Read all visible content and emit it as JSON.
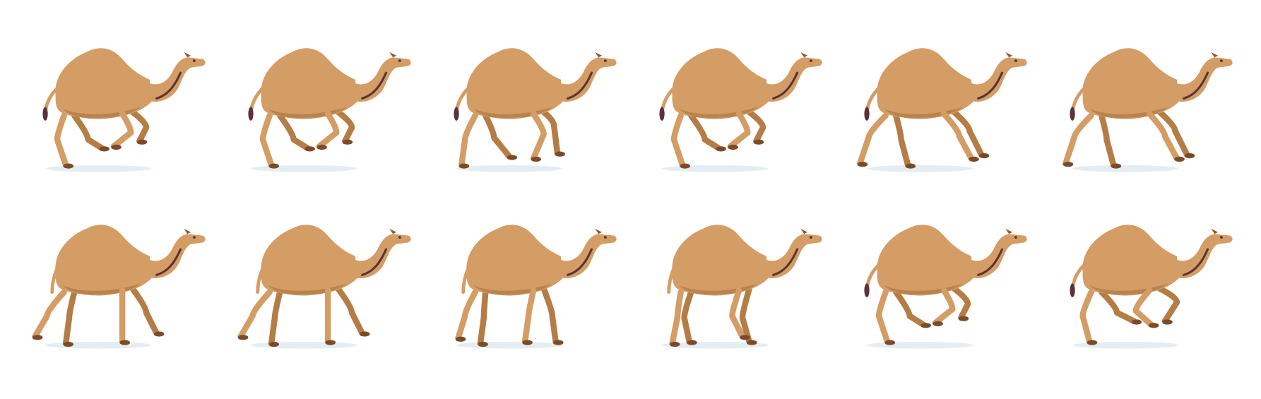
{
  "sprite_sheet": {
    "subject": "camel",
    "colors": {
      "background": "#ffffff",
      "body": "#d39d65",
      "shade": "#b57d46",
      "dark": "#8d5a31",
      "hoof": "#7b4b29",
      "tail": "#5a3337",
      "shadow": "#d9e6ec"
    },
    "frames": [
      {
        "row": 1,
        "col": 1,
        "pose": "gallop-gather"
      },
      {
        "row": 1,
        "col": 2,
        "pose": "gallop-gather"
      },
      {
        "row": 1,
        "col": 3,
        "pose": "gallop-reach"
      },
      {
        "row": 1,
        "col": 4,
        "pose": "gallop-gather"
      },
      {
        "row": 1,
        "col": 5,
        "pose": "gallop-extend"
      },
      {
        "row": 1,
        "col": 6,
        "pose": "gallop-extend"
      },
      {
        "row": 2,
        "col": 1,
        "pose": "stride-wide"
      },
      {
        "row": 2,
        "col": 2,
        "pose": "stride-wide"
      },
      {
        "row": 2,
        "col": 3,
        "pose": "stride-mid"
      },
      {
        "row": 2,
        "col": 4,
        "pose": "stride-cross"
      },
      {
        "row": 2,
        "col": 5,
        "pose": "gallop-gather"
      },
      {
        "row": 2,
        "col": 6,
        "pose": "gallop-tuck"
      }
    ]
  }
}
